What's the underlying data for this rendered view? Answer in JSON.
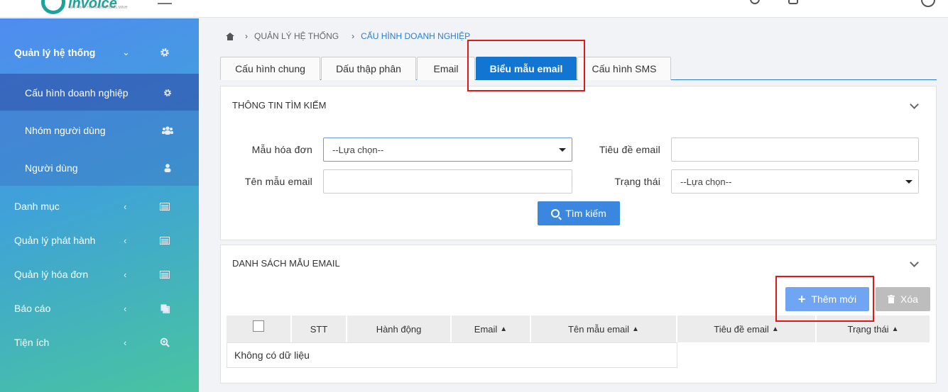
{
  "header": {
    "logo_text": "invoice",
    "logo_subtitle": "GIẢI PHÁP HÓA ĐƠN THÔNG MINH"
  },
  "sidebar": {
    "groups": [
      {
        "label": "Quản lý hệ thống",
        "icon": "gear-icon",
        "expanded": true
      },
      {
        "label": "Danh mục",
        "icon": "list-icon"
      },
      {
        "label": "Quản lý phát hành",
        "icon": "list-icon"
      },
      {
        "label": "Quản lý hóa đơn",
        "icon": "list-icon"
      },
      {
        "label": "Báo cáo",
        "icon": "copy-icon"
      },
      {
        "label": "Tiện ích",
        "icon": "zoom-icon"
      }
    ],
    "subitems": [
      {
        "label": "Cấu hình doanh nghiệp",
        "icon": "gear-icon",
        "active": true
      },
      {
        "label": "Nhóm người dùng",
        "icon": "users-icon"
      },
      {
        "label": "Người dùng",
        "icon": "user-icon"
      }
    ]
  },
  "breadcrumb": {
    "items": [
      "QUẢN LÝ HỆ THỐNG",
      "CẤU HÌNH DOANH NGHIỆP"
    ]
  },
  "tabs": [
    {
      "label": "Cấu hình chung"
    },
    {
      "label": "Dấu thập phân"
    },
    {
      "label": "Email"
    },
    {
      "label": "Biểu mẫu email",
      "active": true
    },
    {
      "label": "Cấu hình SMS"
    }
  ],
  "search_panel": {
    "title": "THÔNG TIN TÌM KIẾM",
    "fields": {
      "invoice_template": {
        "label": "Mẫu hóa đơn",
        "value": "--Lựa chọn--"
      },
      "email_subject": {
        "label": "Tiêu đề email",
        "value": ""
      },
      "email_template_name": {
        "label": "Tên mẫu email",
        "value": ""
      },
      "status": {
        "label": "Trạng thái",
        "value": "--Lựa chọn--"
      }
    },
    "search_button": "Tìm kiếm"
  },
  "list_panel": {
    "title": "DANH SÁCH MẪU EMAIL",
    "add_button": "Thêm mới",
    "delete_button": "Xóa",
    "columns": [
      "STT",
      "Hành động",
      "Email",
      "Tên mẫu email",
      "Tiêu đề email",
      "Trạng thái"
    ],
    "empty_text": "Không có dữ liệu"
  },
  "colors": {
    "accent": "#1275d2",
    "highlight": "#e01818"
  }
}
